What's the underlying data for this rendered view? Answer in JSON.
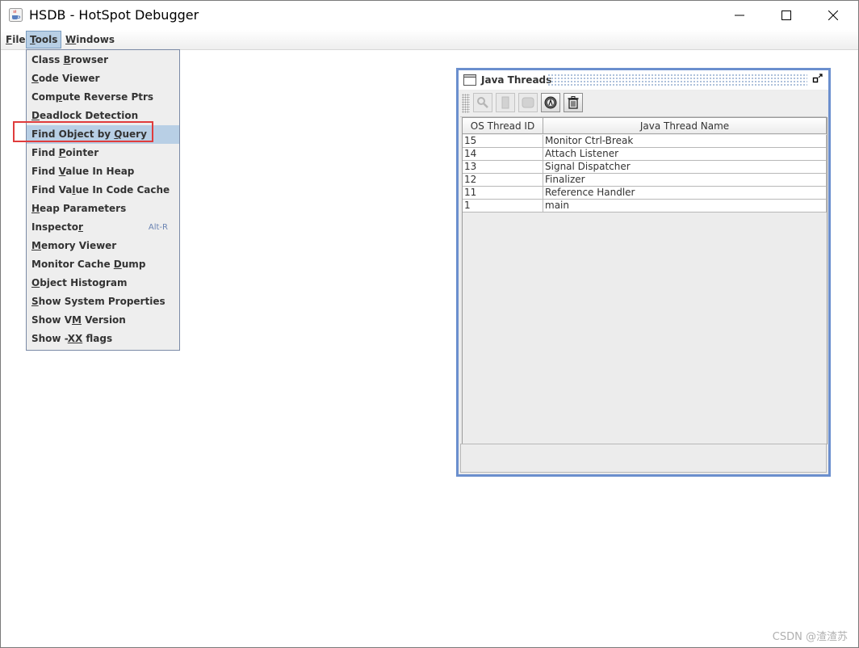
{
  "window": {
    "title": "HSDB - HotSpot Debugger",
    "icon": "java-coffee-icon",
    "controls": [
      "minimize-icon",
      "maximize-icon",
      "close-icon"
    ]
  },
  "menubar": {
    "file": {
      "underlined": "F",
      "rest": "ile"
    },
    "tools": {
      "underlined": "T",
      "rest": "ools"
    },
    "windows": {
      "underlined": "W",
      "rest": "indows"
    }
  },
  "tools_menu": {
    "items": [
      {
        "pre": "Class ",
        "u": "B",
        "post": "rowser"
      },
      {
        "pre": "",
        "u": "C",
        "post": "ode Viewer"
      },
      {
        "pre": "Com",
        "u": "p",
        "post": "ute Reverse Ptrs"
      },
      {
        "pre": "",
        "u": "D",
        "post": "eadlock Detection"
      },
      {
        "pre": "Find Object by ",
        "u": "Q",
        "post": "uery"
      },
      {
        "pre": "Find ",
        "u": "P",
        "post": "ointer"
      },
      {
        "pre": "Find ",
        "u": "V",
        "post": "alue In Heap"
      },
      {
        "pre": "Find Va",
        "u": "l",
        "post": "ue In Code Cache"
      },
      {
        "pre": "",
        "u": "H",
        "post": "eap Parameters"
      },
      {
        "pre": "Inspecto",
        "u": "r",
        "post": "",
        "accel": "Alt-R"
      },
      {
        "pre": "",
        "u": "M",
        "post": "emory Viewer"
      },
      {
        "pre": "Monitor Cache ",
        "u": "D",
        "post": "ump"
      },
      {
        "pre": "",
        "u": "O",
        "post": "bject Histogram"
      },
      {
        "pre": "",
        "u": "S",
        "post": "how System Properties"
      },
      {
        "pre": "Show V",
        "u": "M",
        "post": " Version"
      },
      {
        "pre": "Show -",
        "u": "XX",
        "post": " flags"
      }
    ],
    "highlighted_index": 4
  },
  "java_threads": {
    "title": "Java Threads",
    "toolbar_icons": [
      "inspect-thread-icon",
      "stack-memory-icon",
      "show-stack-icon",
      "find-crashes-icon",
      "trash-icon"
    ],
    "columns": [
      "OS Thread ID",
      "Java Thread Name"
    ],
    "rows": [
      [
        "15",
        "Monitor Ctrl-Break"
      ],
      [
        "14",
        "Attach Listener"
      ],
      [
        "13",
        "Signal Dispatcher"
      ],
      [
        "12",
        "Finalizer"
      ],
      [
        "11",
        "Reference Handler"
      ],
      [
        "1",
        "main"
      ]
    ]
  },
  "watermark": "CSDN @渣渣苏",
  "colors": {
    "accent": "#6b8fce",
    "menu_highlight": "#b8cfe5",
    "annotation_box": "#e03c3c"
  }
}
